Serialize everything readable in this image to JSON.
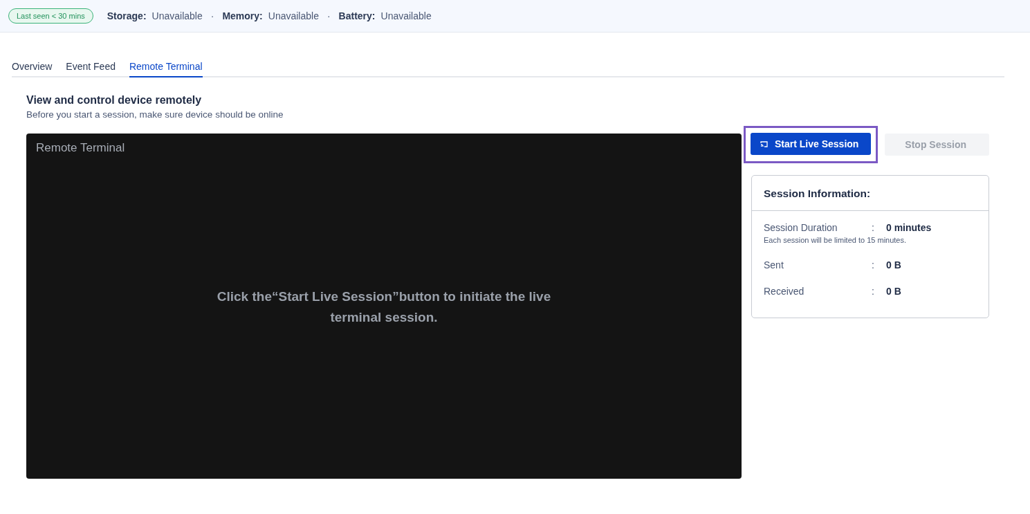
{
  "status_bar": {
    "badge": "Last seen < 30 mins",
    "stats": [
      {
        "label": "Storage:",
        "value": "Unavailable"
      },
      {
        "label": "Memory:",
        "value": "Unavailable"
      },
      {
        "label": "Battery:",
        "value": "Unavailable"
      }
    ],
    "separator": "·"
  },
  "tabs": [
    {
      "label": "Overview",
      "selected": false
    },
    {
      "label": "Event Feed",
      "selected": false
    },
    {
      "label": "Remote Terminal",
      "selected": true
    }
  ],
  "section": {
    "title": "View and control device remotely",
    "subtitle": "Before you start a session, make sure device should be online"
  },
  "terminal": {
    "title": "Remote Terminal",
    "message": "Click the“Start Live Session”button to initiate the live terminal session."
  },
  "buttons": [
    {
      "label": "Start Live Session",
      "kind": "primary",
      "disabled": false,
      "focused": true
    },
    {
      "label": "Stop Session",
      "kind": "secondary",
      "disabled": true,
      "focused": false
    }
  ],
  "session_info": {
    "title": "Session Information:",
    "rows": [
      {
        "label": "Session Duration",
        "value": "0 minutes",
        "note": "Each session will be limited to 15 minutes."
      },
      {
        "label": "Sent",
        "value": "0 B"
      },
      {
        "label": "Received",
        "value": "0 B"
      }
    ],
    "separator": ":"
  }
}
